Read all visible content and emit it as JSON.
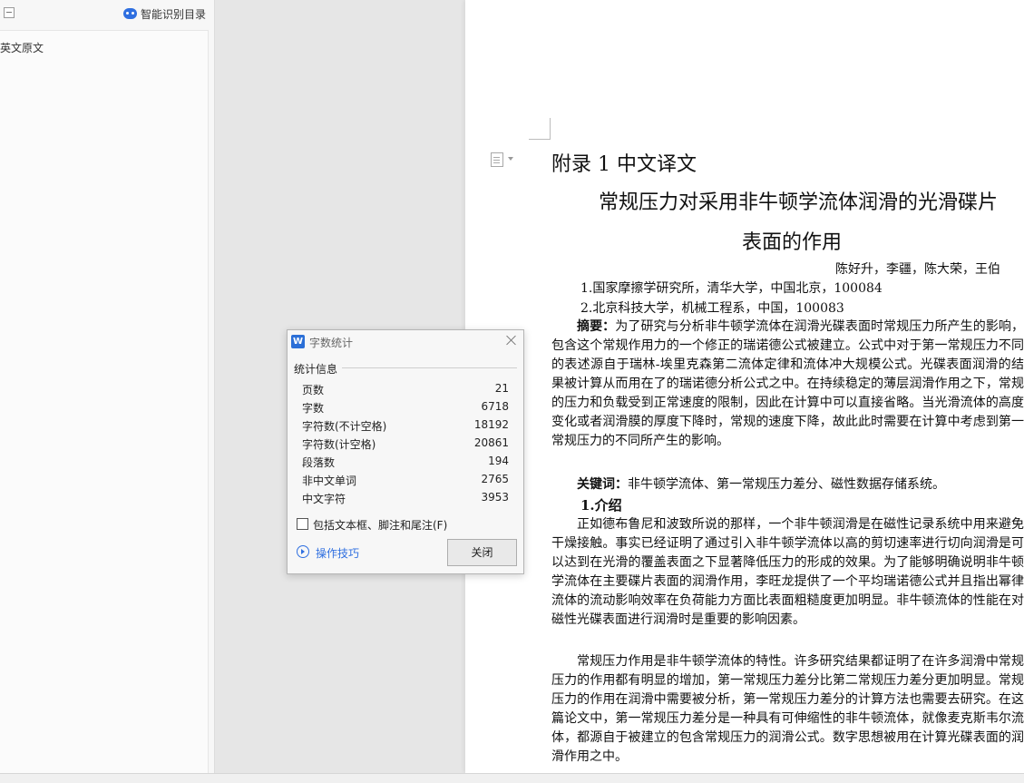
{
  "nav": {
    "smart_toc_label": "智能识别目录",
    "outline_item": "英文原文"
  },
  "document": {
    "appendix_title": "附录 1  中文译文",
    "title_line1": "常规压力对采用非牛顿学流体润滑的光滑碟片",
    "title_line2": "表面的作用",
    "authors": "陈好升，李疆，陈大荣，王伯",
    "affil1": "1.国家摩擦学研究所，清华大学，中国北京，100084",
    "affil2": "2.北京科技大学，机械工程系，中国，100083",
    "abstract_label": "摘要：",
    "abstract_text": "为了研究与分析非牛顿学流体在润滑光碟表面时常规压力所产生的影响，包含这个常规作用力的一个修正的瑞诺德公式被建立。公式中对于第一常规压力不同的表述源自于瑞林-埃里克森第二流体定律和流体冲大规模公式。光碟表面润滑的结果被计算从而用在了的瑞诺德分析公式之中。在持续稳定的薄层润滑作用之下，常规的压力和负载受到正常速度的限制，因此在计算中可以直接省略。当光滑流体的高度变化或者润滑膜的厚度下降时，常规的速度下降，故此此时需要在计算中考虑到第一常规压力的不同所产生的影响。",
    "keywords_label": "关键词：",
    "keywords_text": "非牛顿学流体、第一常规压力差分、磁性数据存储系统。",
    "section_heading": "1.介绍",
    "intro_p1": "正如德布鲁尼和波致所说的那样，一个非牛顿润滑是在磁性记录系统中用来避免干燥接触。事实已经证明了通过引入非牛顿学流体以高的剪切速率进行切向润滑是可以达到在光滑的覆盖表面之下显著降低压力的形成的效果。为了能够明确说明非牛顿学流体在主要碟片表面的润滑作用，李旺龙提供了一个平均瑞诺德公式并且指出幂律流体的流动影响效率在负荷能力方面比表面粗糙度更加明显。非牛顿流体的性能在对磁性光碟表面进行润滑时是重要的影响因素。",
    "intro_p2": "常规压力作用是非牛顿学流体的特性。许多研究结果都证明了在许多润滑中常规压力的作用都有明显的增加，第一常规压力差分比第二常规压力差分更加明显。常规压力的作用在润滑中需要被分析，第一常规压力差分的计算方法也需要去研究。在这篇论文中，第一常规压力差分是一种具有可伸缩性的非牛顿流体，就像麦克斯韦尔流体，都源自于被建立的包含常规压力的润滑公式。数字思想被用在计算光碟表面的润滑作用之中。"
  },
  "dialog": {
    "app_icon_letter": "W",
    "title": "字数统计",
    "section_label": "统计信息",
    "stats": [
      {
        "label": "页数",
        "value": "21"
      },
      {
        "label": "字数",
        "value": "6718"
      },
      {
        "label": "字符数(不计空格)",
        "value": "18192"
      },
      {
        "label": "字符数(计空格)",
        "value": "20861"
      },
      {
        "label": "段落数",
        "value": "194"
      },
      {
        "label": "非中文单词",
        "value": "2765"
      },
      {
        "label": "中文字符",
        "value": "3953"
      }
    ],
    "checkbox_label": "包括文本框、脚注和尾注(F)",
    "tips_label": "操作技巧",
    "close_button": "关闭"
  }
}
